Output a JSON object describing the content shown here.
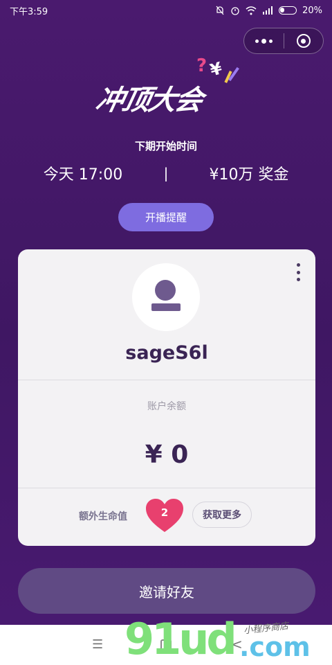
{
  "status_bar": {
    "time": "下午3:59",
    "battery": "20%"
  },
  "logo": {
    "text": "冲顶大会",
    "mark_q": "?",
    "mark_yen": "¥"
  },
  "schedule": {
    "label": "下期开始时间",
    "time": "今天 17:00",
    "divider": "|",
    "prize": "¥10万 奖金"
  },
  "remind_button": "开播提醒",
  "profile": {
    "username": "sageS6l",
    "balance_label": "账户余额",
    "balance_value": "¥ 0",
    "lives_label": "额外生命值",
    "lives_count": "2",
    "get_more": "获取更多"
  },
  "invite_button": "邀请好友",
  "nav": {
    "menu_icon": "☰",
    "back_icon": "<"
  },
  "watermark": {
    "main": "91ud",
    "suffix": ".com",
    "small": "小程序商店"
  },
  "colors": {
    "background": "#4a1a6e",
    "accent": "#7e6ce0",
    "heart": "#e8406e",
    "card": "#f3f2f4"
  }
}
